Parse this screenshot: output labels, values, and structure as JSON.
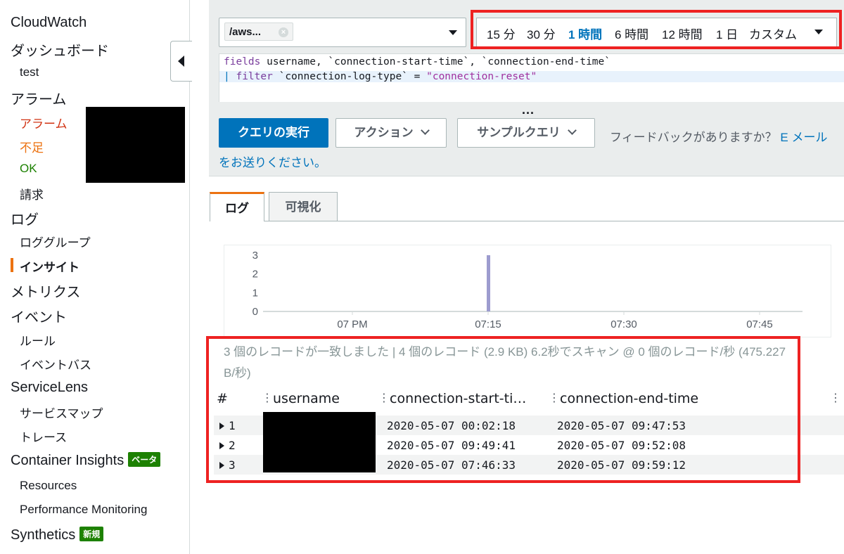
{
  "sidebar": {
    "cloudwatch": "CloudWatch",
    "dashboards": "ダッシュボード",
    "dashboard_test": "test",
    "alarms": "アラーム",
    "alarm_state": "アラーム",
    "insufficient": "不足",
    "ok": "OK",
    "billing": "請求",
    "logs": "ログ",
    "log_groups": "ロググループ",
    "insights": "インサイト",
    "metrics": "メトリクス",
    "events": "イベント",
    "rules": "ルール",
    "event_buses": "イベントバス",
    "servicelens": "ServiceLens",
    "service_map": "サービスマップ",
    "traces": "トレース",
    "container_insights": "Container Insights",
    "beta_badge": "ベータ",
    "resources": "Resources",
    "performance_monitoring": "Performance Monitoring",
    "synthetics": "Synthetics",
    "new_badge": "新規"
  },
  "query": {
    "log_group_chip": "/aws...",
    "time_ranges": [
      "15 分",
      "30 分",
      "1 時間",
      "6 時間",
      "12 時間",
      "1 日",
      "カスタム"
    ],
    "selected_time_range": "1 時間",
    "code_line1_kw": "fields",
    "code_line1_rest": " username, `connection-start-time`, `connection-end-time`",
    "code_line2_pipe": "| ",
    "code_line2_kw": "filter",
    "code_line2_rest": " `connection-log-type` = ",
    "code_line2_str": "\"connection-reset\"",
    "more": "...",
    "run_button": "クエリの実行",
    "actions_button": "アクション",
    "sample_button": "サンプルクエリ",
    "feedback_text": "フィードバックがありますか？",
    "feedback_link": "E メールをお送りください。"
  },
  "tabs": {
    "logs": "ログ",
    "visualization": "可視化"
  },
  "chart_data": {
    "type": "bar",
    "x_ticks": [
      "07 PM",
      "07:15",
      "07:30",
      "07:45"
    ],
    "y_ticks": [
      "0",
      "1",
      "2",
      "3"
    ],
    "ylim": [
      0,
      3
    ],
    "series": [
      {
        "x": [
          "07:15"
        ],
        "values": [
          3
        ]
      }
    ],
    "color": "#9d9ccf"
  },
  "results": {
    "status": "3 個のレコードが一致しました | 4 個のレコード (2.9 KB) 6.2秒でスキャン @ 0 個のレコード/秒 (475.227 B/秒)",
    "columns": [
      "#",
      "username",
      "connection-start-ti…",
      "connection-end-time"
    ],
    "rows": [
      {
        "n": "1",
        "start": "2020-05-07 00:02:18",
        "end": "2020-05-07 09:47:53"
      },
      {
        "n": "2",
        "start": "2020-05-07 09:49:41",
        "end": "2020-05-07 09:52:08"
      },
      {
        "n": "3",
        "start": "2020-05-07 07:46:33",
        "end": "2020-05-07 09:59:12"
      }
    ]
  }
}
